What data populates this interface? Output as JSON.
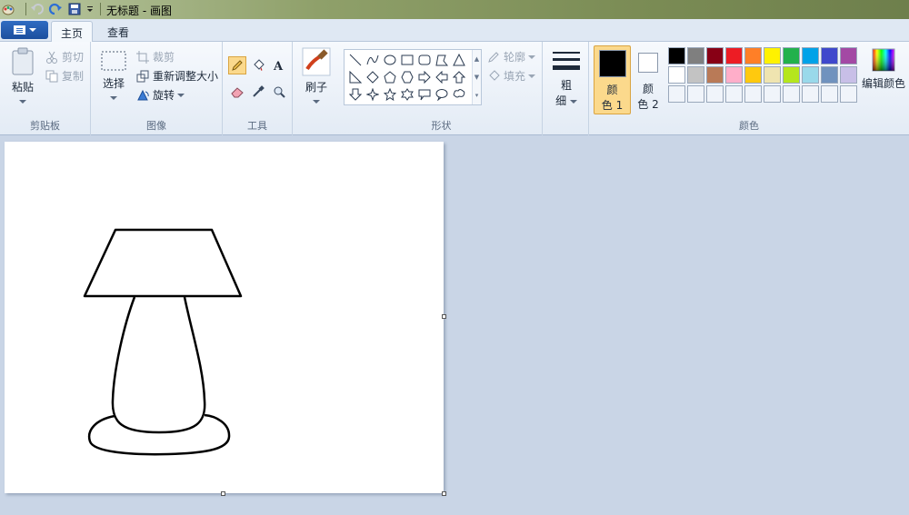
{
  "window": {
    "title": "无标题 - 画图"
  },
  "tabs": [
    {
      "label": "主页",
      "active": true
    },
    {
      "label": "查看",
      "active": false
    }
  ],
  "clipboard": {
    "group_label": "剪贴板",
    "paste": "粘贴",
    "cut": "剪切",
    "copy": "复制"
  },
  "image": {
    "group_label": "图像",
    "select": "选择",
    "crop": "裁剪",
    "resize": "重新调整大小",
    "rotate": "旋转"
  },
  "tools": {
    "group_label": "工具",
    "items": [
      "pencil-icon",
      "fill-icon",
      "text-icon",
      "eraser-icon",
      "color-picker-icon",
      "magnifier-icon"
    ],
    "selected": "pencil-icon"
  },
  "brushes": {
    "label": "刷子"
  },
  "shapes": {
    "group_label": "形状",
    "outline": "轮廓",
    "fill": "填充"
  },
  "size": {
    "label_1": "粗",
    "label_2": "细"
  },
  "colors": {
    "group_label": "颜色",
    "color1_label_1": "颜",
    "color1_label_2": "色 1",
    "color2_label_1": "颜",
    "color2_label_2": "色 2",
    "color1": "#000000",
    "color2": "#ffffff",
    "edit": "编辑颜色",
    "palette": [
      "#000000",
      "#7f7f7f",
      "#880015",
      "#ed1c24",
      "#ff7f27",
      "#fff200",
      "#22b14c",
      "#00a2e8",
      "#3f48cc",
      "#a349a4",
      "#ffffff",
      "#c3c3c3",
      "#b97a57",
      "#ffaec9",
      "#ffc90e",
      "#efe4b0",
      "#b5e61d",
      "#99d9ea",
      "#7092be",
      "#c8bfe7",
      "#f0f4fa",
      "#f0f4fa",
      "#f0f4fa",
      "#f0f4fa",
      "#f0f4fa",
      "#f0f4fa",
      "#f0f4fa",
      "#f0f4fa",
      "#f0f4fa",
      "#f0f4fa"
    ]
  }
}
